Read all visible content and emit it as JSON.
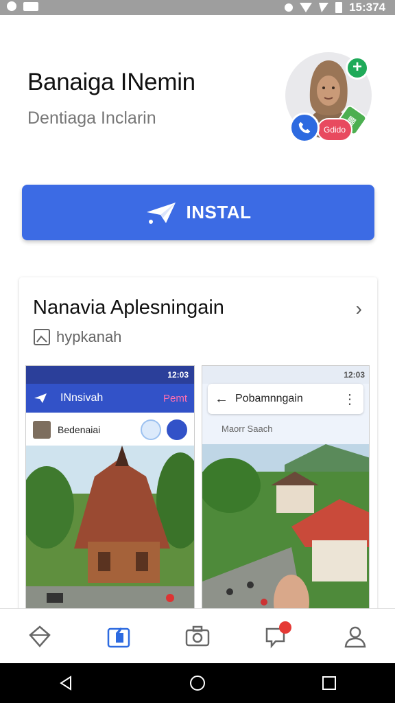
{
  "status_bar": {
    "time": "15:374"
  },
  "app": {
    "name": "Banaiga INemin",
    "developer": "Dentiaga Inclarin",
    "avatar_badge_pill": "Gdido"
  },
  "install_button": {
    "label": "INSTAL"
  },
  "card": {
    "title": "Nanavia Aplesningain",
    "subtitle": "hypkanah",
    "screenshot1": {
      "status_time": "12:03",
      "title": "INnsivah",
      "action": "Pemt",
      "row_label": "Bedenaiai"
    },
    "screenshot2": {
      "status_time": "12:03",
      "search_label": "Pobamnngain",
      "hint": "Maorr Saach"
    }
  },
  "bottom_nav": {
    "items": [
      "home-icon",
      "apps-icon",
      "camera-icon",
      "chat-icon",
      "profile-icon"
    ],
    "active": "apps-icon"
  },
  "colors": {
    "accent": "#3c6be4",
    "status_bar": "#9e9e9e",
    "notification": "#e53935"
  }
}
